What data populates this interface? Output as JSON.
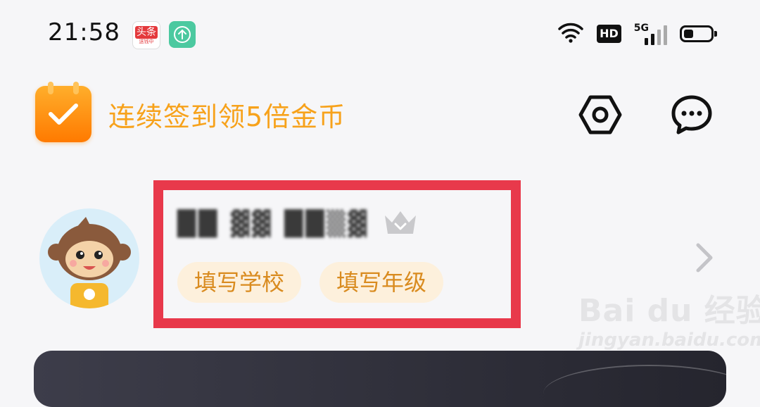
{
  "status_bar": {
    "time": "21:58",
    "notification_icons": [
      "toutiao-app-icon",
      "upload-icon"
    ],
    "toutiao_label": "头条",
    "toutiao_sub": "送钱中",
    "hd_label": "HD",
    "network_label": "5G",
    "battery_level": 0.35
  },
  "header": {
    "checkin_text": "连续签到领5倍金币",
    "settings_icon": "settings-hexagon-icon",
    "messages_icon": "chat-bubble-icon"
  },
  "profile": {
    "username": "██ ▓▓ ██▒▓",
    "username_blurred": true,
    "crown_icon": "crown-icon",
    "tags": [
      {
        "label": "填写学校"
      },
      {
        "label": "填写年级"
      }
    ],
    "highlight_color": "#e8394b"
  },
  "watermark": {
    "brand": "Bai du 经验",
    "url": "jingyan.baidu.com"
  },
  "colors": {
    "accent_orange": "#f7a21b",
    "tag_bg": "#fdf0dc",
    "tag_text": "#d98b1f",
    "background": "#f6f6f8"
  }
}
